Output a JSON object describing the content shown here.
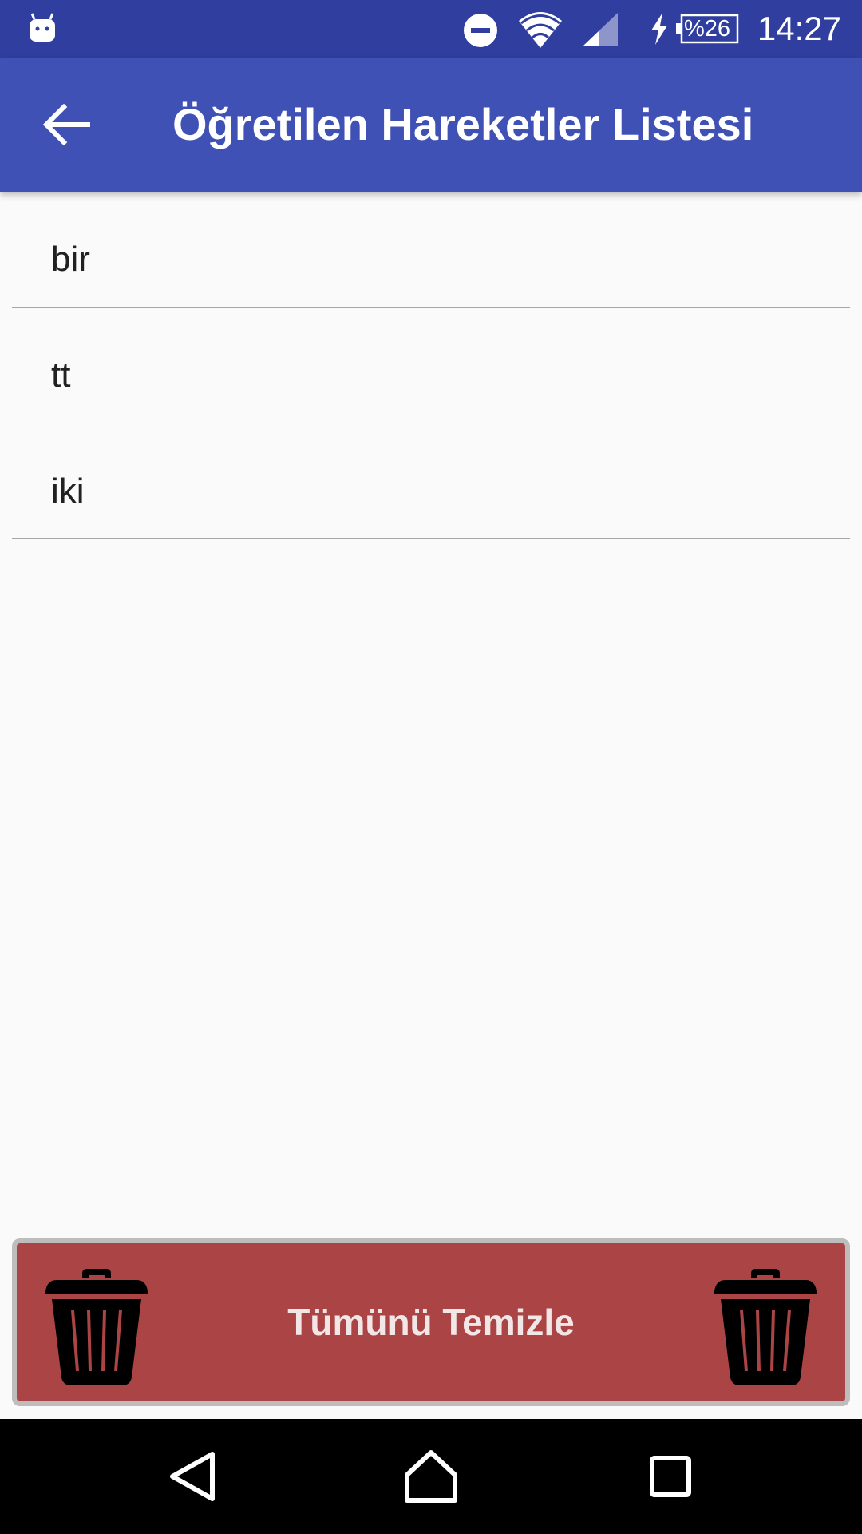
{
  "status_bar": {
    "battery_label": "%26",
    "time": "14:27",
    "icons": [
      "app-notification-icon",
      "do-not-disturb-icon",
      "wifi-icon",
      "cell-signal-icon",
      "charging-bolt-icon",
      "battery-icon"
    ]
  },
  "app_bar": {
    "title": "Öğretilen Hareketler Listesi",
    "back_icon": "arrow-back-icon",
    "color": "#3f51b5"
  },
  "list": {
    "items": [
      {
        "label": "bir"
      },
      {
        "label": "tt"
      },
      {
        "label": "iki"
      }
    ]
  },
  "clear_button": {
    "label": "Tümünü Temizle",
    "icon": "trash-icon",
    "color": "#ab4545"
  },
  "nav_bar": {
    "icons": [
      "nav-back-icon",
      "nav-home-icon",
      "nav-recents-icon"
    ]
  },
  "colors": {
    "status_bar": "#303f9f",
    "background": "#fafafa"
  }
}
